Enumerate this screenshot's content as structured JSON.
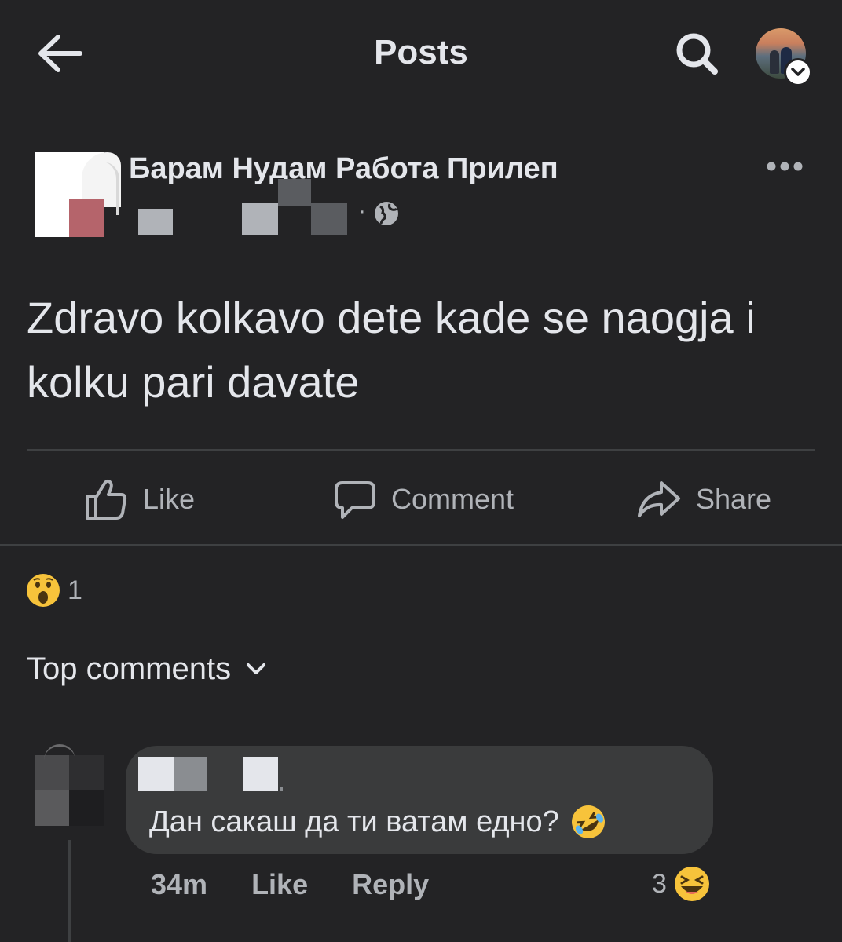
{
  "header": {
    "title": "Posts"
  },
  "post": {
    "page_name": "Барам Нудам Работа Прилеп",
    "text": "Zdravo kolkavo dete kade se naogja i kolku pari davate",
    "actions": {
      "like": "Like",
      "comment": "Comment",
      "share": "Share"
    },
    "reaction_count": "1"
  },
  "comments": {
    "sort_label": "Top comments",
    "items": [
      {
        "text": "Дан сакаш да ти ватам едно?",
        "time": "34m",
        "like_label": "Like",
        "reply_label": "Reply",
        "reaction_count": "3"
      }
    ]
  },
  "colors": {
    "background": "#232325",
    "bubble": "#3a3b3c",
    "text": "#e4e6eb",
    "secondary_text": "#b0b3b8"
  }
}
